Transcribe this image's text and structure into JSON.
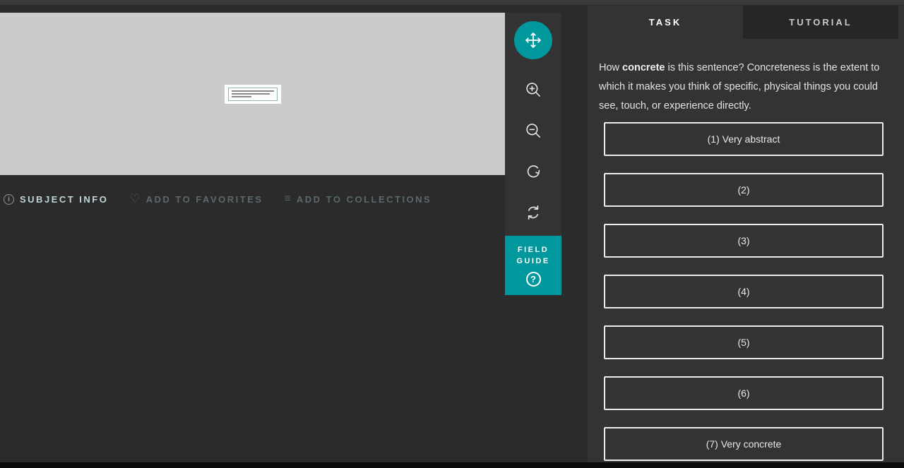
{
  "colors": {
    "accent_teal": "#00979d",
    "page_background": "#2b2b2b",
    "panel_background": "#333333",
    "inactive_tab_background": "#262626",
    "viewer_background": "#cbcbcb",
    "metadata_active_text": "#c2d6d9",
    "metadata_dim_text": "#5a6a6c",
    "bottom_strip": "#0b0b0b"
  },
  "toolbar": {
    "tools": [
      {
        "name": "move",
        "active": true
      },
      {
        "name": "zoom-in",
        "active": false
      },
      {
        "name": "zoom-out",
        "active": false
      },
      {
        "name": "rotate",
        "active": false
      },
      {
        "name": "reset",
        "active": false
      }
    ],
    "field_guide_label": "FIELD GUIDE",
    "field_guide_help_glyph": "?"
  },
  "metadata_bar": {
    "subject_info_label": "SUBJECT INFO",
    "favorites_label": "ADD TO FAVORITES",
    "collections_label": "ADD TO COLLECTIONS",
    "icons": {
      "info_glyph": "i",
      "heart_glyph": "♡",
      "list_glyph": "≡"
    }
  },
  "task_panel": {
    "tabs": [
      {
        "label": "TASK",
        "active": true
      },
      {
        "label": "TUTORIAL",
        "active": false
      }
    ],
    "question": {
      "before": "How ",
      "bold": "concrete",
      "after": " is this sentence? Concreteness is the extent to which it makes you think of specific, physical things you could see, touch, or experience directly."
    },
    "answers": [
      "(1) Very abstract",
      "(2)",
      "(3)",
      "(4)",
      "(5)",
      "(6)",
      "(7) Very concrete"
    ]
  }
}
